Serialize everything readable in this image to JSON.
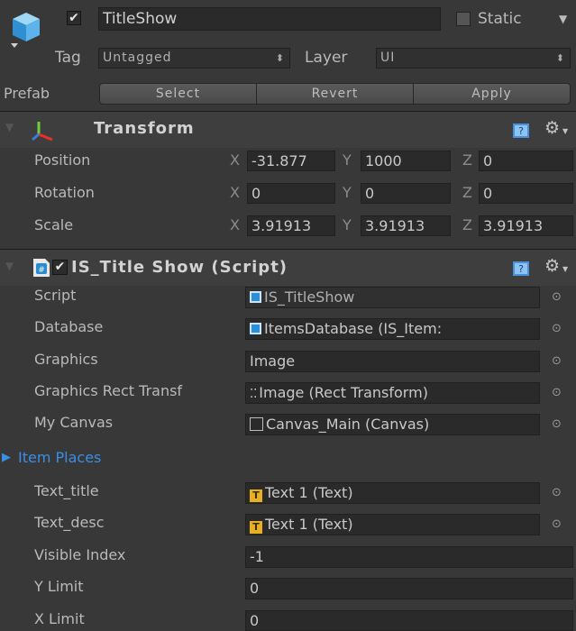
{
  "header": {
    "object_name": "TitleShow",
    "static_label": "Static",
    "tag_label": "Tag",
    "tag_value": "Untagged",
    "layer_label": "Layer",
    "layer_value": "UI",
    "prefab_label": "Prefab",
    "prefab_buttons": [
      "Select",
      "Revert",
      "Apply"
    ]
  },
  "transform": {
    "title": "Transform",
    "rows": [
      {
        "label": "Position",
        "x": "-31.877",
        "y": "1000",
        "z": "0"
      },
      {
        "label": "Rotation",
        "x": "0",
        "y": "0",
        "z": "0"
      },
      {
        "label": "Scale",
        "x": "3.91913",
        "y": "3.91913",
        "z": "3.91913"
      }
    ],
    "axis": {
      "x": "X",
      "y": "Y",
      "z": "Z"
    }
  },
  "script_component": {
    "title": "IS_Title Show (Script)",
    "fields": [
      {
        "label": "Script",
        "value": "IS_TitleShow",
        "icon": "script-file-icon"
      },
      {
        "label": "Database",
        "value": "ItemsDatabase (IS_Item:",
        "icon": "script-file-icon"
      },
      {
        "label": "Graphics",
        "value": "Image",
        "icon": ""
      },
      {
        "label": "Graphics Rect Transf",
        "value": "Image (Rect Transform)",
        "icon": "rect-transform-icon"
      },
      {
        "label": "My Canvas",
        "value": "Canvas_Main (Canvas)",
        "icon": "canvas-icon"
      },
      {
        "label": "Item Places",
        "value": "",
        "icon": ""
      },
      {
        "label": "Text_title",
        "value": "Text 1 (Text)",
        "icon": "text-icon"
      },
      {
        "label": "Text_desc",
        "value": "Text 1 (Text)",
        "icon": "text-icon"
      },
      {
        "label": "Visible Index",
        "value": "-1",
        "icon": ""
      },
      {
        "label": "Y Limit",
        "value": "0",
        "icon": ""
      },
      {
        "label": "X Limit",
        "value": "0",
        "icon": ""
      }
    ]
  },
  "colors": {
    "background": "#383838",
    "field": "#2a2a2a",
    "foldout_blue": "#3a8ee6",
    "text_icon_yellow": "#e8b020"
  }
}
